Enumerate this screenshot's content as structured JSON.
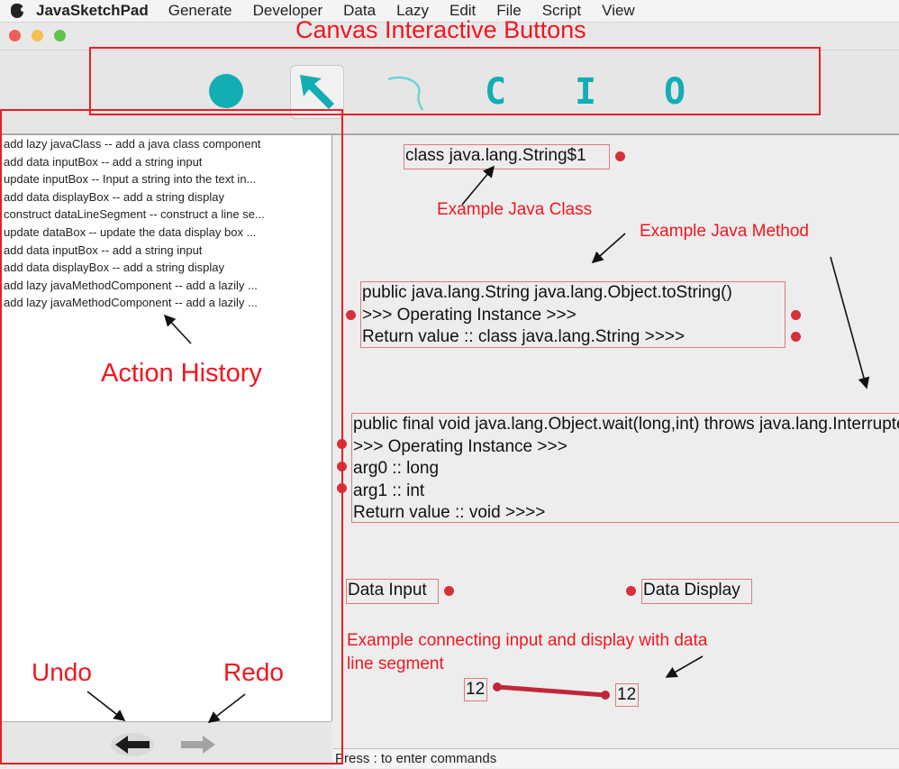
{
  "menubar": {
    "app_name": "JavaSketchPad",
    "items": [
      "Generate",
      "Developer",
      "Data",
      "Lazy",
      "Edit",
      "File",
      "Script",
      "View"
    ]
  },
  "window": {
    "lights": [
      "#ee5f57",
      "#f6be4f",
      "#5ec54a"
    ]
  },
  "toolbar": {
    "accent_color": "#13adb4",
    "tools": [
      {
        "name": "circle-tool",
        "icon": "filled-circle"
      },
      {
        "name": "select-tool",
        "icon": "arrow-pointer",
        "selected": true
      },
      {
        "name": "curve-tool",
        "icon": "curve-line"
      },
      {
        "name": "class-tool",
        "label": "C"
      },
      {
        "name": "input-tool",
        "label": "I"
      },
      {
        "name": "output-tool",
        "label": "O"
      }
    ]
  },
  "history": [
    "add lazy javaClass -- add a java class component",
    "add data inputBox -- add a string input",
    "update inputBox -- Input a string into the text in...",
    "add data displayBox -- add a string display",
    "construct dataLineSegment -- construct a line se...",
    "update dataBox -- update the data display box ...",
    "add data inputBox -- add a string input",
    "add data displayBox -- add a string display",
    "add lazy javaMethodComponent -- add a lazily ...",
    "add lazy javaMethodComponent -- add a lazily ..."
  ],
  "canvas": {
    "class_component": "class java.lang.String$1",
    "method1_lines": [
      "public java.lang.String java.lang.Object.toString()",
      ">>> Operating Instance  >>>",
      "Return value :: class java.lang.String >>>>"
    ],
    "method2_lines": [
      "public final void java.lang.Object.wait(long,int) throws java.lang.InterruptedException",
      ">>> Operating Instance  >>>",
      "arg0 :: long",
      "arg1 :: int",
      "Return value :: void >>>>"
    ],
    "data_input": "Data Input",
    "data_display": "Data Display",
    "input_value": "12",
    "display_value": "12"
  },
  "status": "Press : to enter commands",
  "annotations": {
    "canvas_buttons": "Canvas Interactive Buttons",
    "java_class": "Example Java Class",
    "java_method": "Example Java Method",
    "action_history": "Action History",
    "connecting_line1": "Example connecting input and display with data",
    "connecting_line2": "line segment",
    "undo": "Undo",
    "redo": "Redo"
  },
  "colors": {
    "annotation_red": "#f2161f",
    "port_red": "#d6303a",
    "component_border": "#e07a7a",
    "line_segment": "#c0283a"
  }
}
